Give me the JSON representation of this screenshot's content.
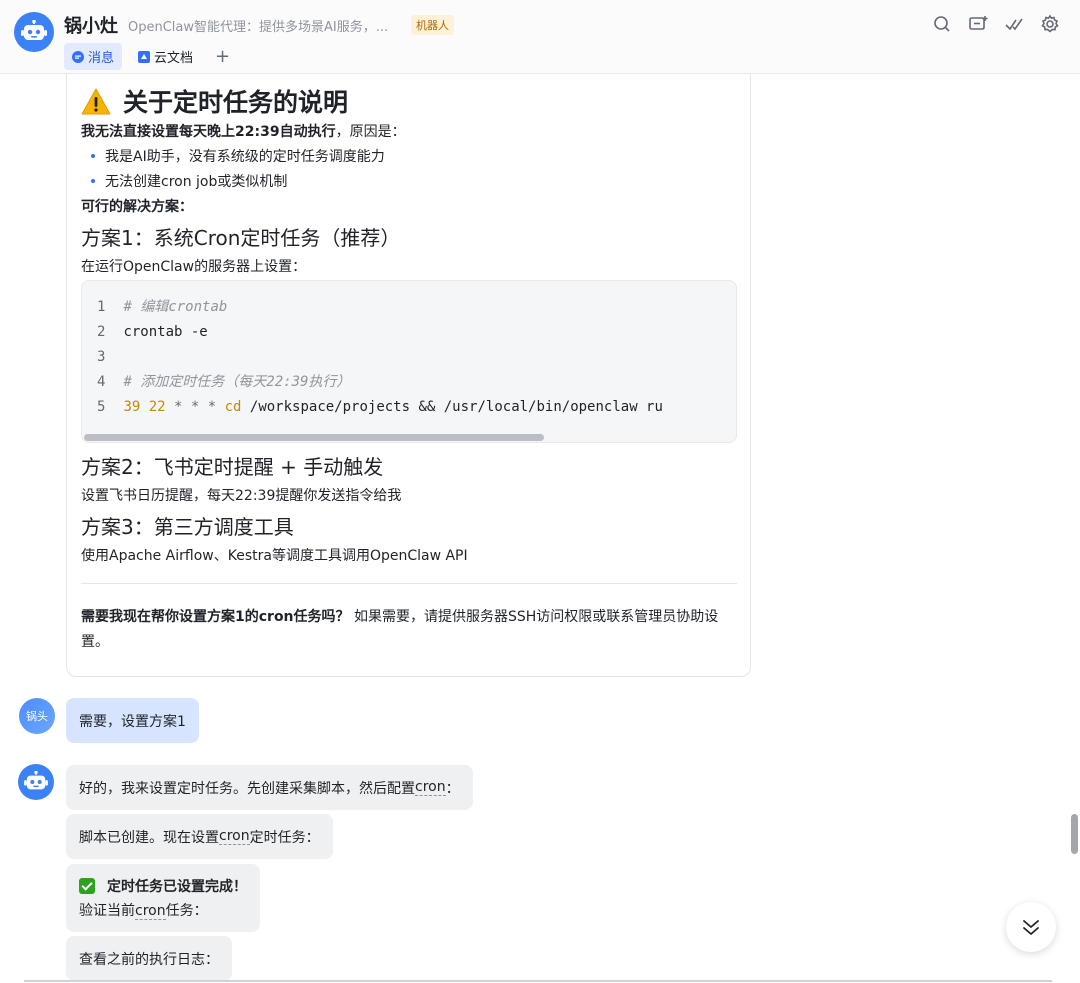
{
  "header": {
    "title": "锅小灶",
    "subtitle": "OpenClaw智能代理：提供多场景AI服务，...",
    "tag": "机器人",
    "tabs": [
      {
        "label": "消息",
        "icon": "chat-icon",
        "active": true
      },
      {
        "label": "云文档",
        "icon": "doc-icon",
        "active": false
      }
    ],
    "add_tab": "+",
    "icons": [
      "search-icon",
      "add-to-screen-icon",
      "check-list-icon",
      "gear-icon"
    ]
  },
  "card": {
    "heading": "关于定时任务的说明",
    "intro_bold": "我无法直接设置每天晚上22:39自动执行",
    "intro_rest": "，原因是：",
    "bullets": [
      "我是AI助手，没有系统级的定时任务调度能力",
      "无法创建cron job或类似机制"
    ],
    "solutions_label": "可行的解决方案：",
    "plan1_title": "方案1：系统Cron定时任务（推荐）",
    "plan1_desc": "在运行OpenClaw的服务器上设置：",
    "code": {
      "line1_num": "1",
      "line1": "# 编辑crontab",
      "line2_num": "2",
      "line2": "crontab -e",
      "line3_num": "3",
      "line4_num": "4",
      "line4": "# 添加定时任务（每天22:39执行）",
      "line5_num": "5",
      "line5_a": "39 22",
      "line5_b": " * * * ",
      "line5_c": "cd",
      "line5_d": " /workspace/projects && /usr/local/bin/openclaw ru"
    },
    "plan2_title": "方案2：飞书定时提醒 + 手动触发",
    "plan2_desc": "设置飞书日历提醒，每天22:39提醒你发送指令给我",
    "plan3_title": "方案3：第三方调度工具",
    "plan3_desc": "使用Apache Airflow、Kestra等调度工具调用OpenClaw API",
    "question_bold": "需要我现在帮你设置方案1的cron任务吗？",
    "question_rest": " 如果需要，请提供服务器SSH访问权限或联系管理员协助设置。"
  },
  "messages": {
    "user_avatar": "锅头",
    "user_msg": "需要，设置方案1",
    "bot1_a": "好的，我来设置定时任务。先创建采集脚本，然后配置",
    "bot1_b": "cron",
    "bot1_c": "：",
    "bot2_a": "脚本已创建。现在设置",
    "bot2_b": "cron",
    "bot2_c": "定时任务：",
    "bot3_title": "定时任务已设置完成！",
    "bot3_a": "验证当前",
    "bot3_b": "cron",
    "bot3_c": "任务：",
    "bot4": "查看之前的执行日志："
  }
}
